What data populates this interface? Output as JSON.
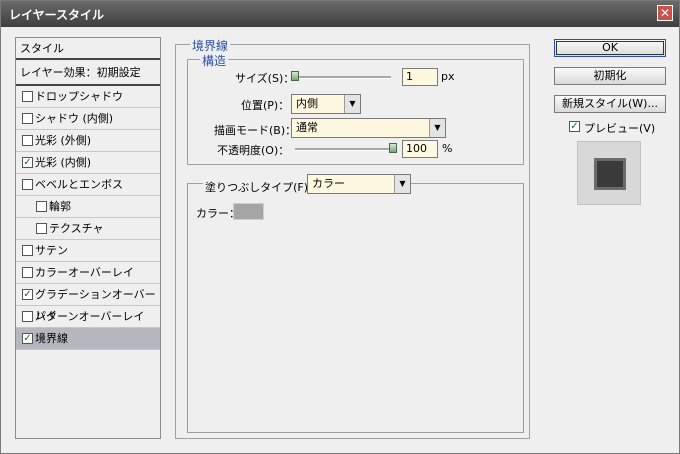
{
  "window": {
    "title": "レイヤースタイル",
    "close_glyph": "✕"
  },
  "left_panel": {
    "header_styles": "スタイル",
    "header_blend": "レイヤー効果：初期設定",
    "items": [
      {
        "label": "ドロップシャドウ",
        "checked": false,
        "indent": false,
        "selected": false
      },
      {
        "label": "シャドウ (内側)",
        "checked": false,
        "indent": false,
        "selected": false
      },
      {
        "label": "光彩 (外側)",
        "checked": false,
        "indent": false,
        "selected": false
      },
      {
        "label": "光彩 (内側)",
        "checked": true,
        "indent": false,
        "selected": false
      },
      {
        "label": "ベベルとエンボス",
        "checked": false,
        "indent": false,
        "selected": false
      },
      {
        "label": "輪郭",
        "checked": false,
        "indent": true,
        "selected": false
      },
      {
        "label": "テクスチャ",
        "checked": false,
        "indent": true,
        "selected": false
      },
      {
        "label": "サテン",
        "checked": false,
        "indent": false,
        "selected": false
      },
      {
        "label": "カラーオーバーレイ",
        "checked": false,
        "indent": false,
        "selected": false
      },
      {
        "label": "グラデーションオーバーレイ",
        "checked": true,
        "indent": false,
        "selected": false
      },
      {
        "label": "パターンオーバーレイ",
        "checked": false,
        "indent": false,
        "selected": false
      },
      {
        "label": "境界線",
        "checked": true,
        "indent": false,
        "selected": true
      }
    ]
  },
  "stroke": {
    "section_title": "境界線",
    "structure_title": "構造",
    "size_label": "サイズ(S)：",
    "size_value": "1",
    "size_unit": "px",
    "position_label": "位置(P)：",
    "position_value": "内側",
    "blend_label": "描画モード(B)：",
    "blend_value": "通常",
    "opacity_label": "不透明度(O)：",
    "opacity_value": "100",
    "opacity_unit": "%",
    "fill_type_label": "塗りつぶしタイプ(F)：",
    "fill_type_value": "カラー",
    "color_label": "カラー：",
    "color_value": "#a5a5a5"
  },
  "buttons": {
    "ok": "OK",
    "reset": "初期化",
    "new_style": "新規スタイル(W)...",
    "preview_label": "プレビュー(V)",
    "preview_checked": true
  }
}
